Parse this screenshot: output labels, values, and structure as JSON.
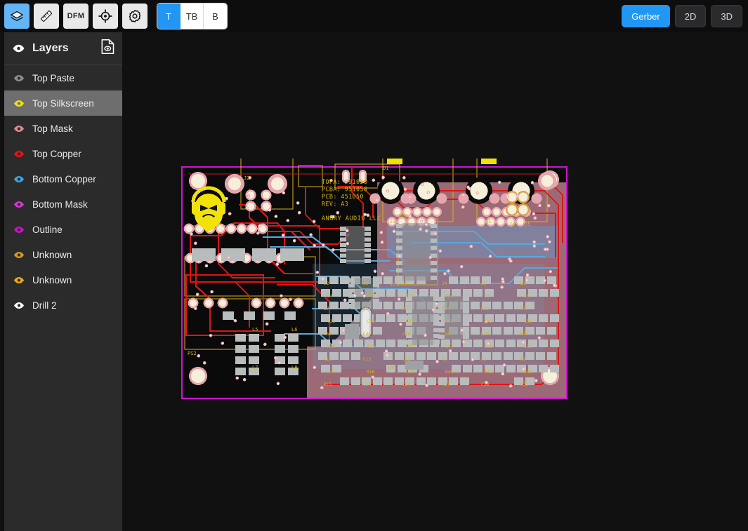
{
  "toolbar": {
    "tools": [
      {
        "name": "layers-tool",
        "icon": "layers-icon",
        "active": true
      },
      {
        "name": "measure-tool",
        "icon": "ruler-icon",
        "active": false
      },
      {
        "name": "dfm-tool",
        "icon": "dfm-text",
        "label": "DFM",
        "active": false
      },
      {
        "name": "align-tool",
        "icon": "crosshair-icon",
        "active": false
      },
      {
        "name": "settings-tool",
        "icon": "gear-icon",
        "active": false
      }
    ],
    "side_segments": [
      {
        "label": "T",
        "active": true
      },
      {
        "label": "TB",
        "active": false
      },
      {
        "label": "B",
        "active": false
      }
    ],
    "view_modes": [
      {
        "label": "Gerber",
        "active": true
      },
      {
        "label": "2D",
        "active": false
      },
      {
        "label": "3D",
        "active": false
      }
    ]
  },
  "sidebar": {
    "title": "Layers",
    "header_icon": "document-eye-icon",
    "header_eye_color": "#ffffff",
    "items": [
      {
        "label": "Top Paste",
        "eye_color": "#8d8d8d",
        "selected": false
      },
      {
        "label": "Top Silkscreen",
        "eye_color": "#f2e205",
        "selected": true
      },
      {
        "label": "Top Mask",
        "eye_color": "#e08a8a",
        "selected": false
      },
      {
        "label": "Top Copper",
        "eye_color": "#ee1111",
        "selected": false
      },
      {
        "label": "Bottom Copper",
        "eye_color": "#3aa6e8",
        "selected": false
      },
      {
        "label": "Bottom Mask",
        "eye_color": "#d03ad0",
        "selected": false
      },
      {
        "label": "Outline",
        "eye_color": "#d608d6",
        "selected": false
      },
      {
        "label": "Unknown",
        "eye_color": "#d79a18",
        "selected": false
      },
      {
        "label": "Unknown",
        "eye_color": "#f0a81e",
        "selected": false
      },
      {
        "label": "Drill 2",
        "eye_color": "#ffffff",
        "selected": false
      }
    ]
  },
  "board": {
    "silkscreen_text": [
      "TOPA: 991050",
      "PCBA: 951050",
      "PCB: 451050",
      "REV: A3"
    ],
    "company": "ANGRY AUDIO LLC",
    "logo": "angry-face-logo",
    "reference_designators": [
      "J2",
      "J3",
      "J1",
      "J4",
      "J5",
      "D1",
      "D4",
      "IC3",
      "IC5",
      "PS2",
      "L5",
      "L6",
      "L7",
      "L8",
      "R21",
      "R24",
      "R23",
      "R17",
      "C26",
      "C36",
      "C37",
      "R45",
      "R42",
      "C51",
      "C52",
      "C45",
      "C38",
      "C24",
      "R16",
      "R19",
      "R20",
      "R39",
      "C47",
      "R47",
      "C28",
      "C16",
      "C18",
      "C13",
      "C12",
      "R1",
      "R3",
      "R9",
      "R14",
      "R16",
      "C30",
      "R48",
      "R43",
      "R45",
      "R15",
      "C24",
      "C54",
      "R37",
      "C38",
      "R33",
      "C35",
      "D9",
      "C31",
      "C43",
      "C40",
      "R49"
    ],
    "colors": {
      "substrate": "#9c6a76",
      "bare": "#0a0a0a",
      "outline": "#cf15cf",
      "silkscreen": "#d9b21c",
      "top_copper": "#e01414",
      "bottom_copper": "#5aa8dd",
      "pad_fill": "#f6efd9",
      "pad_ring": "#e6a6ad",
      "mask_pad": "#b9bcbd",
      "logo": "#f2e205"
    }
  }
}
